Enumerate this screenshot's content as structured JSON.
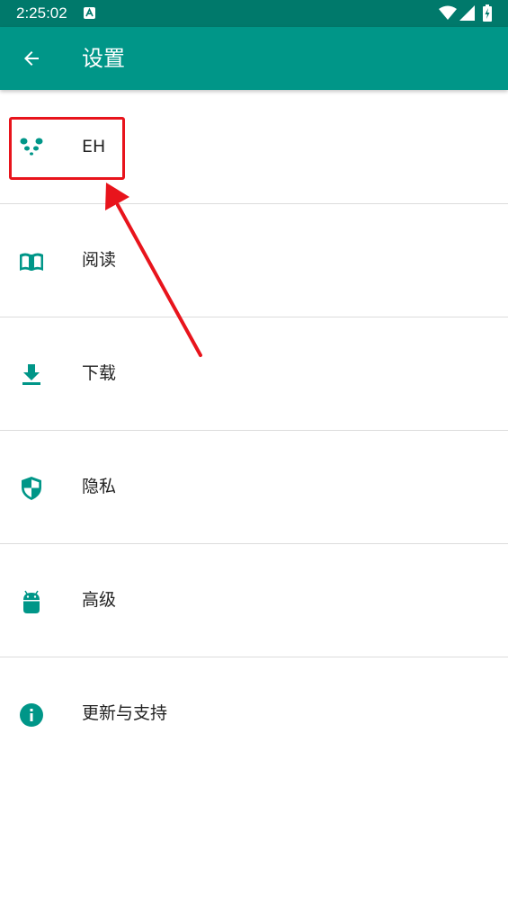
{
  "status_bar": {
    "time": "2:25:02",
    "icons": [
      "notification-a-icon",
      "wifi-icon",
      "signal-icon",
      "battery-charging-icon"
    ]
  },
  "app_bar": {
    "back_icon": "arrow-back-icon",
    "title": "设置"
  },
  "settings": [
    {
      "icon": "panda-icon",
      "label": "EH"
    },
    {
      "icon": "book-open-icon",
      "label": "阅读"
    },
    {
      "icon": "download-icon",
      "label": "下载"
    },
    {
      "icon": "shield-icon",
      "label": "隐私"
    },
    {
      "icon": "android-icon",
      "label": "高级"
    },
    {
      "icon": "info-icon",
      "label": "更新与支持"
    }
  ],
  "colors": {
    "status_bar": "#00796b",
    "app_bar": "#009688",
    "accent": "#009688",
    "annotation": "#e8141c"
  },
  "annotation": {
    "type": "arrow-and-box",
    "target": "EH"
  }
}
